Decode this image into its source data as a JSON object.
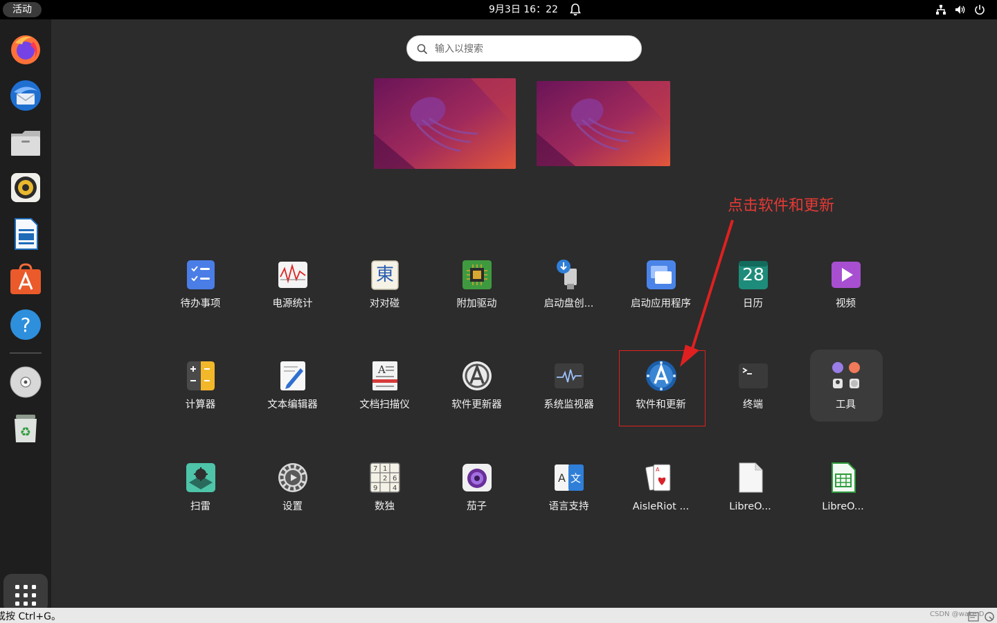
{
  "topbar": {
    "activities_label": "活动",
    "clock": "9月3日  16：22"
  },
  "icons": {
    "bell": "bell-icon",
    "network": "network-icon",
    "volume": "volume-icon",
    "power": "power-icon"
  },
  "dock": {
    "items": [
      {
        "name": "firefox"
      },
      {
        "name": "thunderbird"
      },
      {
        "name": "files"
      },
      {
        "name": "rhythmbox"
      },
      {
        "name": "libreoffice-writer"
      },
      {
        "name": "app-center"
      },
      {
        "name": "help"
      },
      {
        "name": "disc"
      },
      {
        "name": "trash"
      }
    ]
  },
  "search": {
    "placeholder": "输入以搜索"
  },
  "annotation": {
    "text": "点击软件和更新"
  },
  "apps": {
    "row1": [
      "待办事项",
      "电源统计",
      "对对碰",
      "附加驱动",
      "启动盘创...",
      "启动应用程序",
      "日历",
      "视频"
    ],
    "row2": [
      "计算器",
      "文本编辑器",
      "文档扫描仪",
      "软件更新器",
      "系统监视器",
      "软件和更新",
      "终端",
      "工具"
    ],
    "row3": [
      "扫雷",
      "设置",
      "数独",
      "茄子",
      "语言支持",
      "AisleRiot ...",
      "LibreO...",
      "LibreO..."
    ],
    "calendar_day": "28",
    "mahjongg_glyph": "東"
  },
  "bottom": {
    "status_text": "或按 Ctrl+G。",
    "watermark": "CSDN @wake D"
  },
  "colors": {
    "accent_red": "#e53935",
    "background": "#2c2c2c"
  }
}
